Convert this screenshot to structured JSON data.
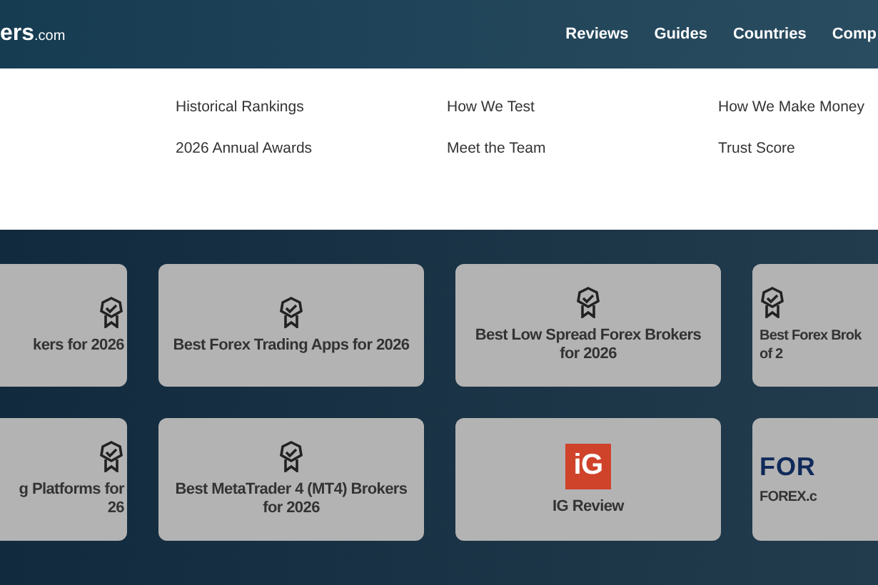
{
  "logo": {
    "text": "ers",
    "suffix": ".com"
  },
  "nav": [
    "Reviews",
    "Guides",
    "Countries",
    "Comp"
  ],
  "dropdown": [
    [
      "Historical Rankings",
      "2026 Annual Awards"
    ],
    [
      "How We Test",
      "Meet the Team"
    ],
    [
      "How We Make Money",
      "Trust Score"
    ]
  ],
  "cards": [
    [
      {
        "kind": "award",
        "lines": [
          "kers for 2026"
        ]
      },
      {
        "kind": "award",
        "lines": [
          "Best Forex Trading Apps for 2026"
        ]
      },
      {
        "kind": "award",
        "lines": [
          "Best Low Spread Forex Brokers",
          "for 2026"
        ]
      },
      {
        "kind": "award",
        "lines": [
          "Best Forex Brok",
          "of 2"
        ]
      }
    ],
    [
      {
        "kind": "award",
        "lines": [
          "g Platforms for",
          "26"
        ]
      },
      {
        "kind": "award",
        "lines": [
          "Best MetaTrader 4 (MT4) Brokers",
          "for 2026"
        ]
      },
      {
        "kind": "ig-logo",
        "logo_text": "iG",
        "lines": [
          "IG Review"
        ]
      },
      {
        "kind": "forex-logo",
        "logo_text": "FOR",
        "lines": [
          "FOREX.c"
        ]
      }
    ]
  ]
}
